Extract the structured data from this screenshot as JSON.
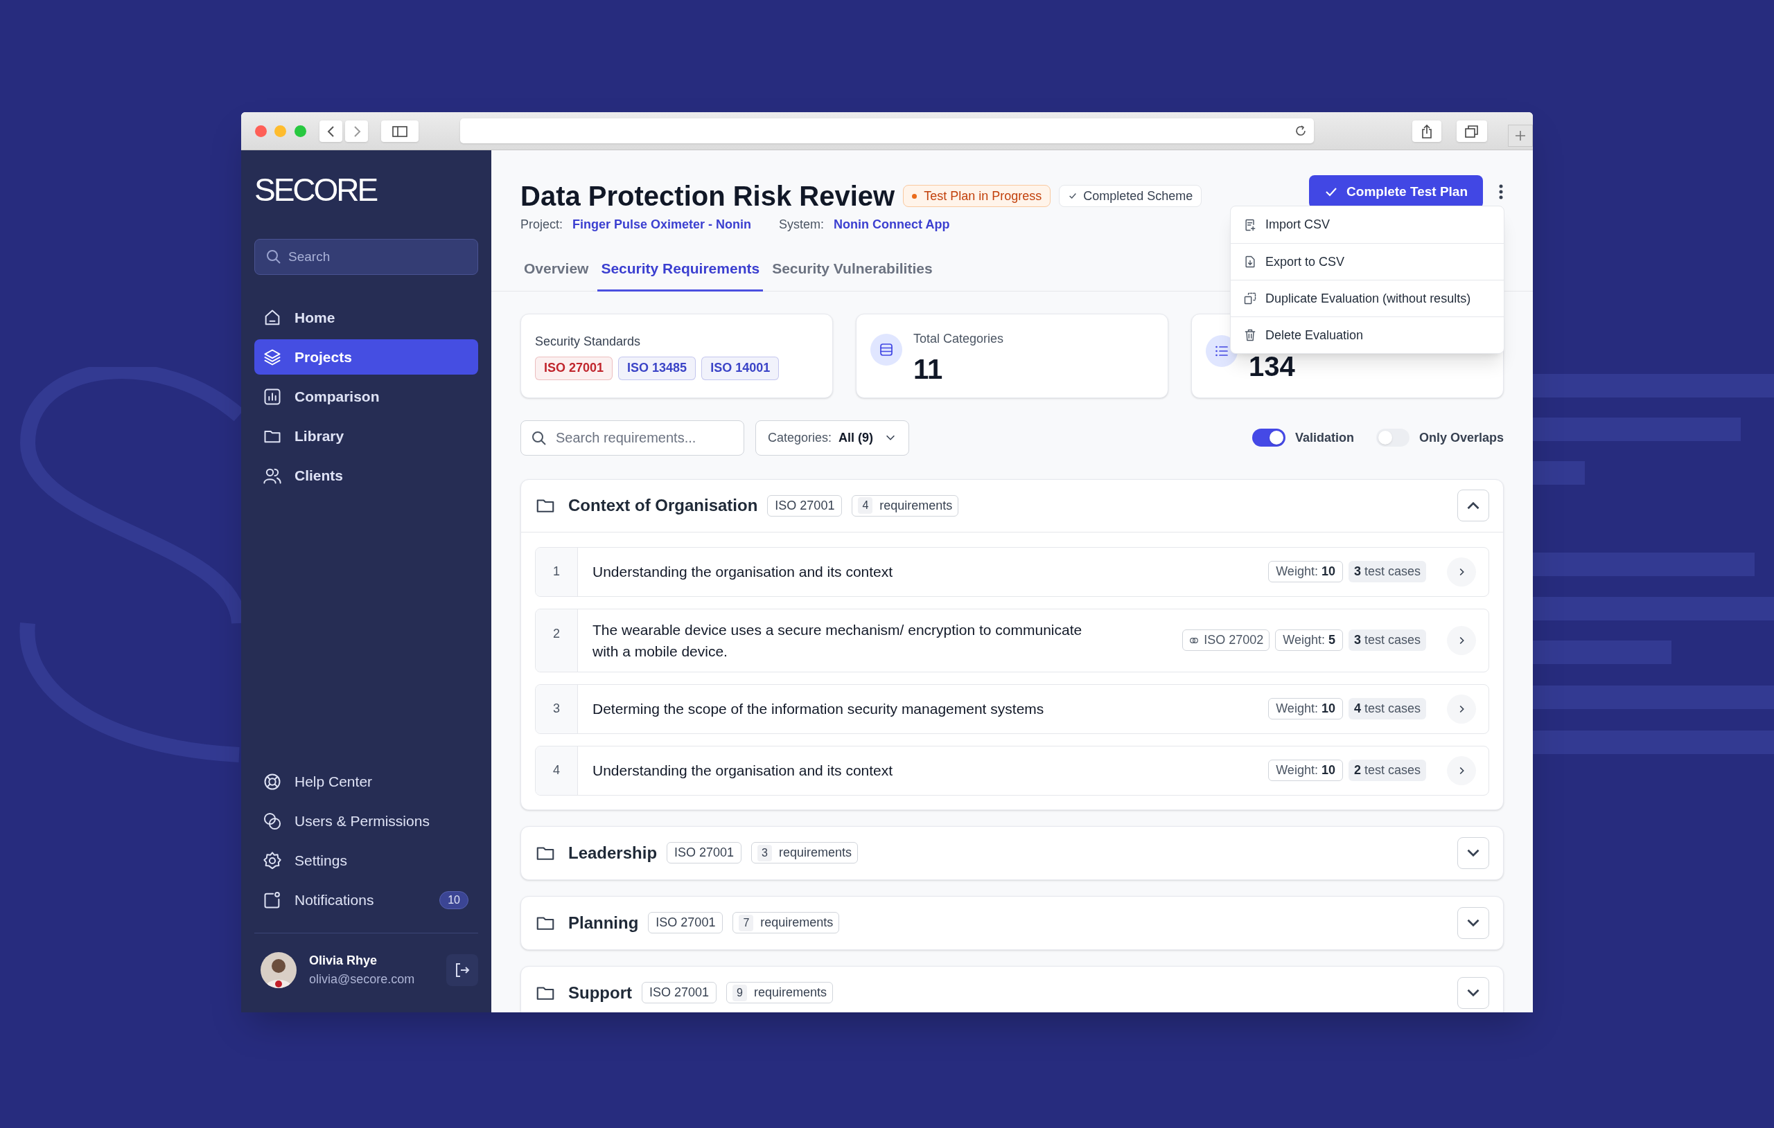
{
  "sidebar": {
    "logo": "SECORE",
    "search": {
      "placeholder": "Search"
    },
    "nav": [
      {
        "label": "Home",
        "selected": false
      },
      {
        "label": "Projects",
        "selected": true
      },
      {
        "label": "Comparison",
        "selected": false
      },
      {
        "label": "Library",
        "selected": false
      },
      {
        "label": "Clients",
        "selected": false
      }
    ],
    "footer_nav": [
      {
        "label": "Help Center"
      },
      {
        "label": "Users & Permissions"
      },
      {
        "label": "Settings"
      },
      {
        "label": "Notifications",
        "badge": "10"
      }
    ],
    "user": {
      "name": "Olivia Rhye",
      "email": "olivia@secore.com"
    }
  },
  "header": {
    "title": "Data Protection Risk Review",
    "badges": [
      {
        "label": "Test Plan in Progress",
        "kind": "status"
      },
      {
        "label": "Completed Scheme",
        "kind": "check"
      }
    ],
    "meta": [
      {
        "label": "Project:",
        "value": "Finger Pulse Oximeter - Nonin"
      },
      {
        "label": "System:",
        "value": "Nonin Connect App"
      }
    ],
    "primary_button": "Complete Test Plan"
  },
  "menu": [
    {
      "label": "Import CSV"
    },
    {
      "label": "Export to CSV"
    },
    {
      "label": "Duplicate Evaluation (without results)"
    },
    {
      "label": "Delete Evaluation"
    }
  ],
  "tabs": [
    {
      "label": "Overview",
      "selected": false
    },
    {
      "label": "Security Requirements",
      "selected": true
    },
    {
      "label": "Security Vulnerabilities",
      "selected": false
    }
  ],
  "standards": {
    "label": "Security Standards",
    "tags": [
      {
        "label": "ISO 27001",
        "color": "#c0262d"
      },
      {
        "label": "ISO 13485",
        "color": "#3b44c7"
      },
      {
        "label": "ISO 14001",
        "color": "#3b44c7"
      }
    ]
  },
  "stats": [
    {
      "label": "Total Categories",
      "value": "11"
    },
    {
      "value": "134"
    }
  ],
  "filters": {
    "search": {
      "placeholder": "Search requirements..."
    },
    "categories": {
      "label": "Categories:",
      "value": "All (9)"
    }
  },
  "toggles": [
    {
      "label": "Validation",
      "on": true
    },
    {
      "label": "Only Overlaps",
      "on": false
    }
  ],
  "groups": [
    {
      "title": "Context of Organisation",
      "standard": "ISO 27001",
      "count": "4",
      "count_label": "requirements",
      "expanded": true,
      "rows": [
        {
          "number": "1",
          "text": "Understanding the organisation and its context",
          "weight_label": "Weight:",
          "weight": "10",
          "cases": "3",
          "cases_label": "test cases"
        },
        {
          "number": "2",
          "text": "The wearable device uses a secure mechanism/ encryption to communicate with a mobile device.",
          "link": "ISO 27002",
          "weight_label": "Weight:",
          "weight": "5",
          "cases": "3",
          "cases_label": "test cases"
        },
        {
          "number": "3",
          "text": "Determing the scope of the information security management systems",
          "weight_label": "Weight:",
          "weight": "10",
          "cases": "4",
          "cases_label": "test cases"
        },
        {
          "number": "4",
          "text": "Understanding the organisation and its context",
          "weight_label": "Weight:",
          "weight": "10",
          "cases": "2",
          "cases_label": "test cases"
        }
      ]
    },
    {
      "title": "Leadership",
      "standard": "ISO 27001",
      "count": "3",
      "count_label": "requirements",
      "expanded": false
    },
    {
      "title": "Planning",
      "standard": "ISO 27001",
      "count": "7",
      "count_label": "requirements",
      "expanded": false
    },
    {
      "title": "Support",
      "standard": "ISO 27001",
      "count": "9",
      "count_label": "requirements",
      "expanded": false
    }
  ]
}
